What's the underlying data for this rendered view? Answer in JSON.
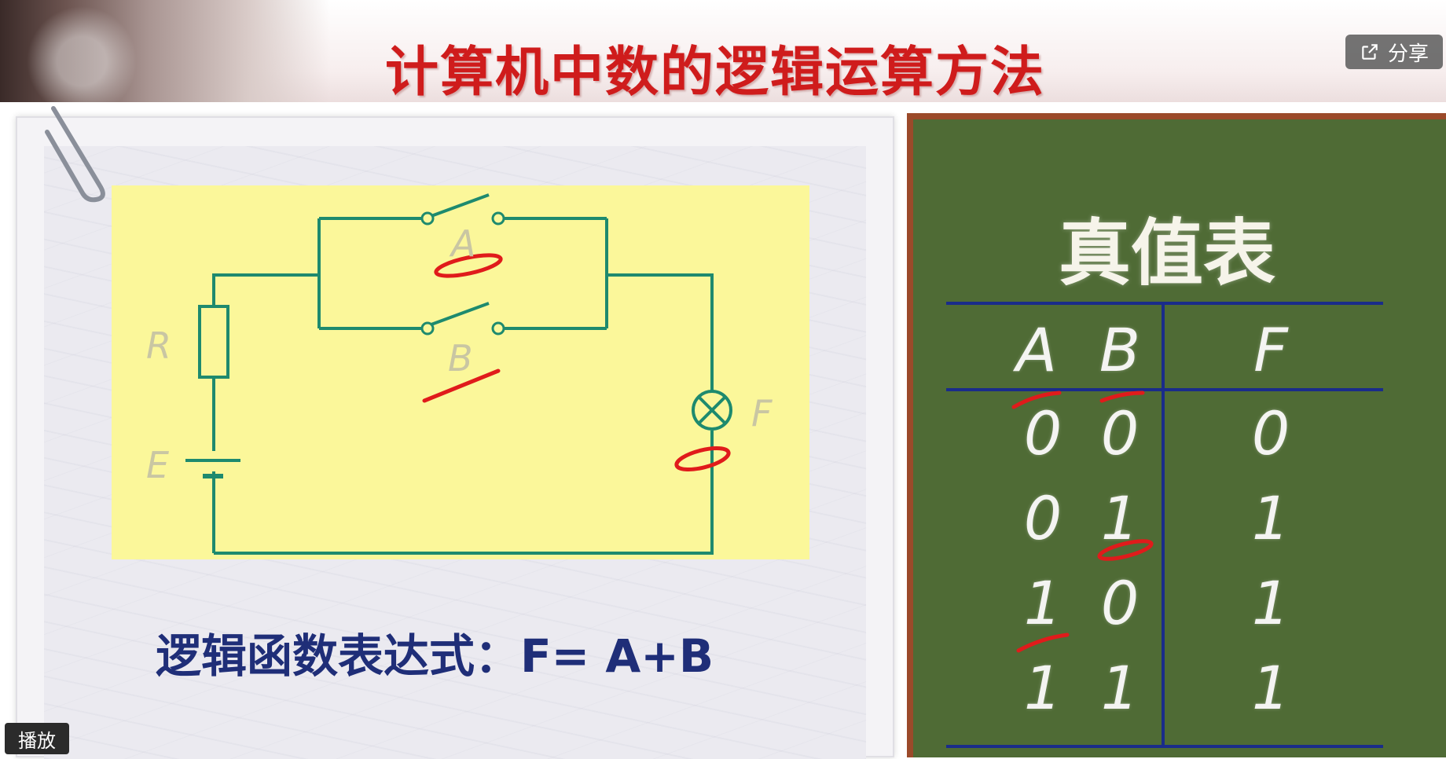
{
  "slide": {
    "title": "计算机中数的逻辑运算方法",
    "formula": "逻辑函数表达式：F= A+B"
  },
  "circuit": {
    "labels": {
      "A": "A",
      "B": "B",
      "R": "R",
      "E": "E",
      "F": "F"
    },
    "colors": {
      "wire": "#1e8a6e",
      "label": "#c9c6a3",
      "mark": "#e01b1b",
      "box": "#fbf79a"
    }
  },
  "truth_table": {
    "title": "真值表",
    "headers": [
      "A",
      "B",
      "F"
    ],
    "rows": [
      [
        "0",
        "0",
        "0"
      ],
      [
        "0",
        "1",
        "1"
      ],
      [
        "1",
        "0",
        "1"
      ],
      [
        "1",
        "1",
        "1"
      ]
    ],
    "colors": {
      "board": "#4f6b35",
      "frame": "#9b4a2a",
      "line": "#1a2c8a",
      "chalk": "#f4f4f2"
    }
  },
  "controls": {
    "share_label": "分享",
    "play_label": "播放",
    "share_icon": "share-icon"
  }
}
